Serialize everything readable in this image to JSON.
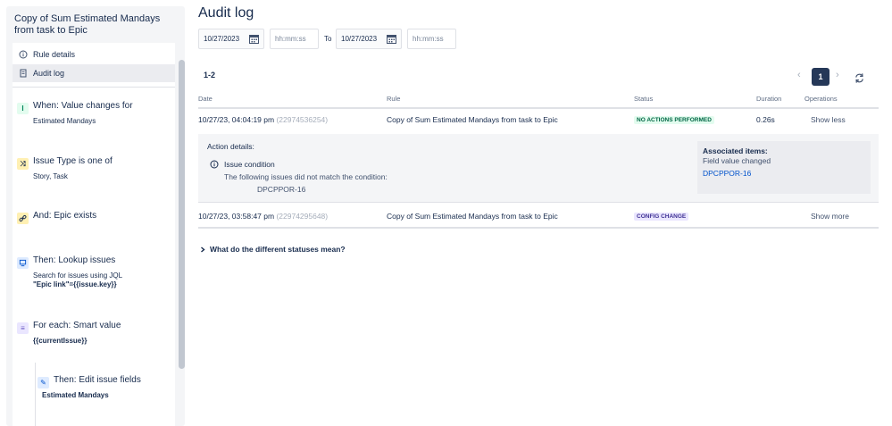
{
  "sidebar": {
    "title": "Copy of Sum Estimated Mandays from task to Epic",
    "nav": [
      {
        "label": "Rule details",
        "icon": "info-icon"
      },
      {
        "label": "Audit log",
        "icon": "document-icon"
      }
    ],
    "steps": [
      {
        "title": "When: Value changes for",
        "desc": "Estimated Mandays",
        "icon": "trigger-icon",
        "color": "#00875a",
        "bg": "#e3fcef"
      },
      {
        "title": "Issue Type is one of",
        "desc": "Story, Task",
        "icon": "shuffle-icon",
        "color": "#172b4d",
        "bg": "#fff0b3"
      },
      {
        "title": "And: Epic exists",
        "desc": "",
        "icon": "link-icon",
        "color": "#172b4d",
        "bg": "#fff0b3"
      },
      {
        "title": "Then: Lookup issues",
        "desc": "Search for issues using JQL",
        "desc2": "\"Epic link\"={{issue.key}}",
        "icon": "lookup-icon",
        "color": "#0052cc",
        "bg": "#deebff"
      },
      {
        "title": "For each: Smart value",
        "desc": "{{currentIssue}}",
        "icon": "list-icon",
        "color": "#6554c0",
        "bg": "#eae6ff"
      },
      {
        "title": "Then: Edit issue fields",
        "desc": "Estimated Mandays",
        "icon": "pencil-icon",
        "color": "#0052cc",
        "bg": "#deebff"
      }
    ]
  },
  "main": {
    "title": "Audit log",
    "filters": {
      "from_date": "10/27/2023",
      "from_time_placeholder": "hh:mm:ss",
      "to_label": "To",
      "to_date": "10/27/2023",
      "to_time_placeholder": "hh:mm:ss"
    },
    "range": "1-2",
    "pagination": {
      "current": "1",
      "prev": "‹",
      "next": "›"
    },
    "columns": {
      "date": "Date",
      "rule": "Rule",
      "status": "Status",
      "duration": "Duration",
      "operations": "Operations"
    },
    "rows": [
      {
        "date": "10/27/23, 04:04:19 pm",
        "id": "(22974536254)",
        "rule": "Copy of Sum Estimated Mandays from task to Epic",
        "status": "NO ACTIONS PERFORMED",
        "duration": "0.26s",
        "operation": "Show less"
      },
      {
        "date": "10/27/23, 03:58:47 pm",
        "id": "(22974295648)",
        "rule": "Copy of Sum Estimated Mandays from task to Epic",
        "status": "CONFIG CHANGE",
        "duration": "",
        "operation": "Show more"
      }
    ],
    "details": {
      "title": "Action details:",
      "condition": "Issue condition",
      "message": "The following issues did not match the condition:",
      "issue_key": "DPCPPOR-16",
      "assoc_title": "Associated items:",
      "assoc_sub": "Field value changed",
      "assoc_link": "DPCPPOR-16"
    },
    "faq": "What do the different statuses mean?"
  },
  "colors": {
    "primary": "#253858",
    "link": "#0052cc",
    "success_bg": "#e3fcef",
    "config_bg": "#eae6ff"
  }
}
